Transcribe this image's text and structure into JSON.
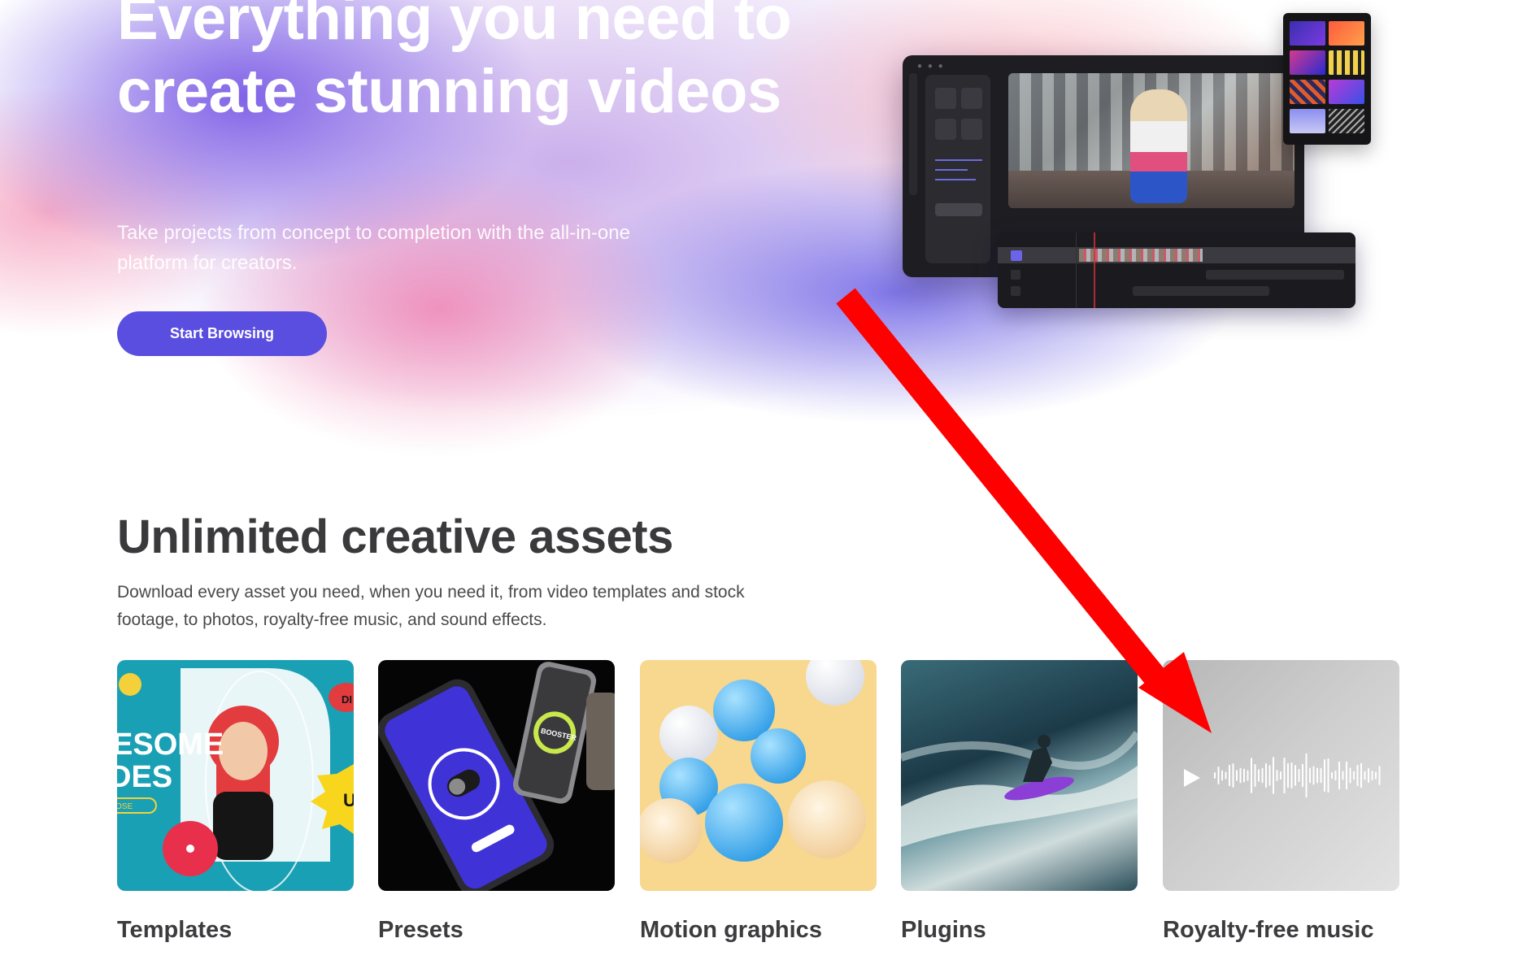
{
  "hero": {
    "title": "Everything you need to create stunning videos",
    "subtitle": "Take projects from concept to completion with the all-in-one platform for creators.",
    "cta_label": "Start Browsing"
  },
  "assets": {
    "title": "Unlimited creative assets",
    "subtitle": "Download every asset you need, when you need it, from video templates and stock footage, to photos, royalty-free music, and sound effects.",
    "categories": [
      {
        "label": "Templates",
        "image_text": [
          "ESOME",
          "DES",
          "OSE",
          "DI",
          "U"
        ]
      },
      {
        "label": "Presets",
        "image_text": [
          "BOOSTER"
        ]
      },
      {
        "label": "Motion graphics"
      },
      {
        "label": "Plugins"
      },
      {
        "label": "Royalty-free music"
      }
    ]
  },
  "colors": {
    "cta": "#5a4ee0",
    "annotation_arrow": "#ff0000",
    "heading": "#3a3a3c"
  }
}
